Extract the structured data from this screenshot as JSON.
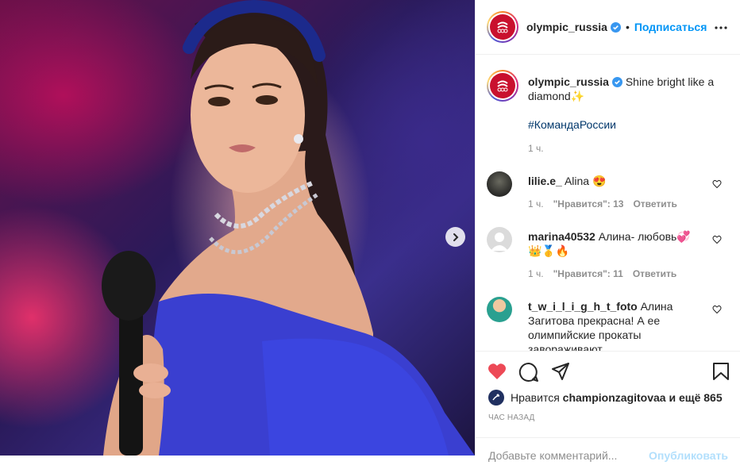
{
  "header": {
    "username": "olympic_russia",
    "separator": "•",
    "follow_label": "Подписаться"
  },
  "caption": {
    "username": "olympic_russia",
    "text": "Shine bright like a diamond✨",
    "hashtag": "#КомандаРоссии",
    "time": "1 ч."
  },
  "comments": [
    {
      "username": "lilie.e_",
      "text": "Alina 😍",
      "time": "1 ч.",
      "likes": "\"Нравится\": 13",
      "reply": "Ответить"
    },
    {
      "username": "marina40532",
      "text": "Алина- любовь💞👑🥇🔥",
      "time": "1 ч.",
      "likes": "\"Нравится\": 11",
      "reply": "Ответить"
    },
    {
      "username": "t_w_i_l_i_g_h_t_foto",
      "text": "Алина Загитова прекрасна! А ее олимпийские прокаты завораживают"
    }
  ],
  "likes": {
    "prefix": "Нравится",
    "user": "championzagitovaa",
    "suffix": "и ещё 865"
  },
  "time_ago": "час назад",
  "comment_input": {
    "placeholder": "Добавьте комментарий...",
    "publish_label": "Опубликовать"
  },
  "colors": {
    "accent": "#0095f6",
    "like_red": "#ed4956",
    "text": "#262626",
    "muted": "#8e8e8e"
  }
}
